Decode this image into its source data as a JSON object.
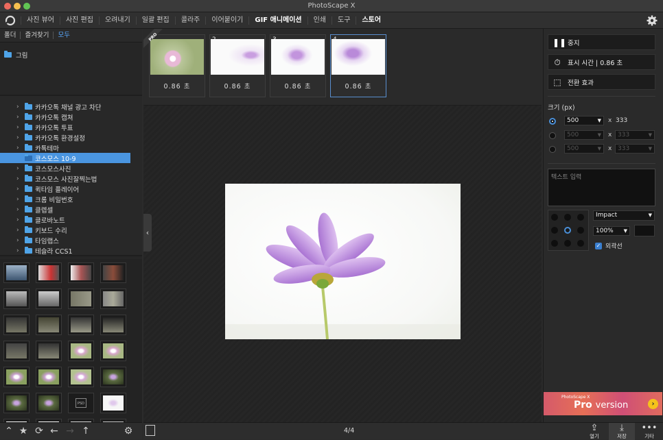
{
  "app": {
    "title": "PhotoScape X"
  },
  "menu": {
    "items": [
      "사진 뷰어",
      "사진 편집",
      "오려내기",
      "일괄 편집",
      "콜라주",
      "이어붙이기",
      "GIF 애니메이션",
      "인쇄",
      "도구",
      "스토어"
    ],
    "active": "GIF 애니메이션"
  },
  "left": {
    "tabs": [
      "폴더",
      "즐겨찾기",
      "모두"
    ],
    "root": "그림",
    "tree": [
      {
        "label": "카카오톡 채널 광고 차단",
        "type": "folder"
      },
      {
        "label": "카카오톡 캡쳐",
        "type": "folder"
      },
      {
        "label": "카카오톡 투표",
        "type": "folder"
      },
      {
        "label": "카카오톡 환경설정",
        "type": "folder"
      },
      {
        "label": "카톡테마",
        "type": "folder"
      },
      {
        "label": "코스모스 10-9",
        "type": "folder-selected"
      },
      {
        "label": "코스모스사진",
        "type": "folder"
      },
      {
        "label": "코스모스 사진잘찍는법",
        "type": "folder"
      },
      {
        "label": "퀵타임 플레이어",
        "type": "folder"
      },
      {
        "label": "크롬 비밀번호",
        "type": "folder"
      },
      {
        "label": "클렙셀",
        "type": "folder"
      },
      {
        "label": "클로바노트",
        "type": "folder"
      },
      {
        "label": "키보드 수리",
        "type": "folder"
      },
      {
        "label": "타임랩스",
        "type": "folder"
      },
      {
        "label": "테슬라 CCS1",
        "type": "folder"
      }
    ],
    "thumb_psd_label": "PSD"
  },
  "frames": {
    "pro_badge": "PRO",
    "items": [
      {
        "num": "1",
        "duration": "0.86 초"
      },
      {
        "num": "2",
        "duration": "0.86 초"
      },
      {
        "num": "3",
        "duration": "0.86 초"
      },
      {
        "num": "4",
        "duration": "0.86 초"
      }
    ]
  },
  "right": {
    "stop": "중지",
    "display_time": "표시 시간 | 0.86 초",
    "transition": "전환 효과",
    "size_label": "크기 (px)",
    "size_rows": [
      {
        "w": "500",
        "h": "333",
        "enabled": true
      },
      {
        "w": "500",
        "h": "333",
        "enabled": false
      },
      {
        "w": "500",
        "h": "333",
        "enabled": false
      }
    ],
    "x_label": "x",
    "text_placeholder": "텍스트 입력",
    "font": "Impact",
    "zoom": "100%",
    "outline": "외곽선",
    "ad": {
      "small": "PhotoScape X",
      "big": "Pro",
      "version": "version"
    }
  },
  "bottom": {
    "counter": "4/4",
    "open": "열기",
    "save": "저장",
    "other": "기타"
  },
  "colors": {
    "accent": "#4a95e0",
    "selected_tree": "#4a95e0"
  }
}
